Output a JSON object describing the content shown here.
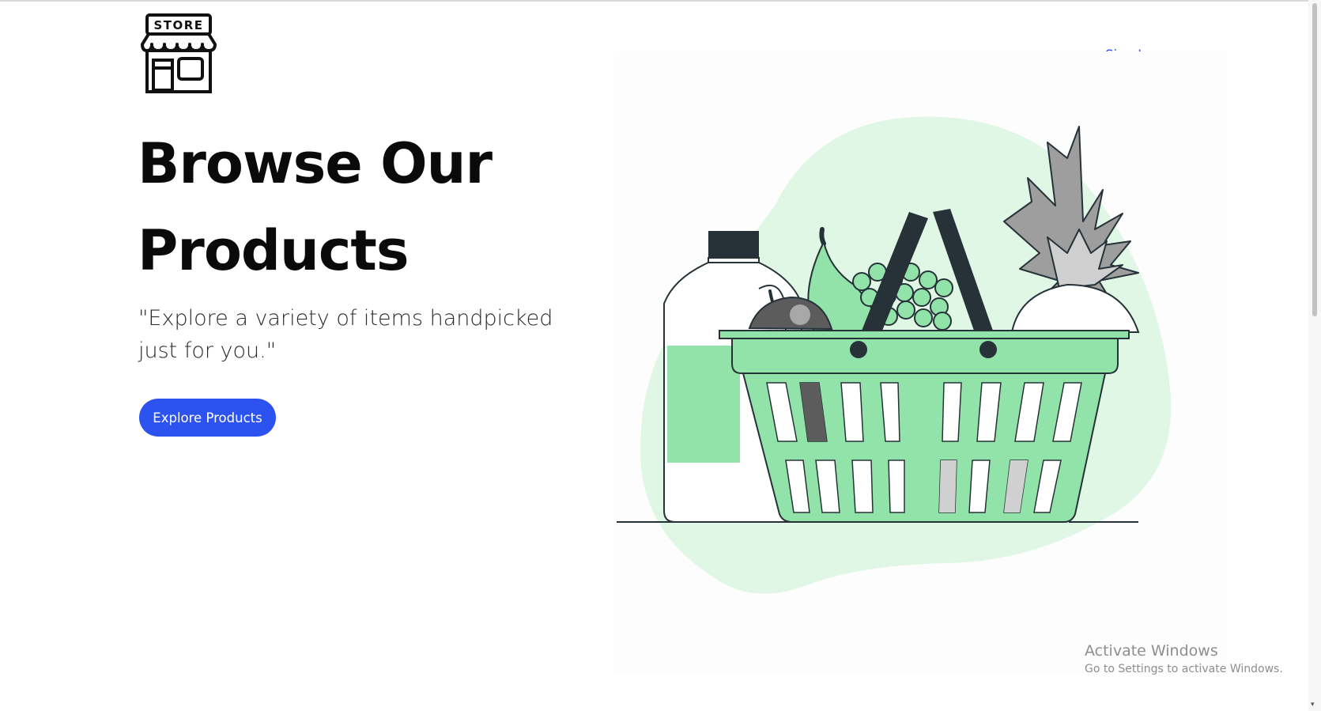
{
  "header": {
    "logo_text": "STORE",
    "signin_label": "Sign In"
  },
  "hero": {
    "title_line1": "Browse Our",
    "title_line2": "Products",
    "subtitle": "\"Explore a variety of items handpicked just for you.\"",
    "cta_label": "Explore Products"
  },
  "illustration": {
    "icon": "grocery-basket-illustration"
  },
  "watermark": {
    "title": "Activate Windows",
    "subtitle": "Go to Settings to activate Windows."
  },
  "colors": {
    "accent": "#2c53f0",
    "illustration_green": "#92e3a9",
    "blob_green": "#e0f7e6",
    "dark_outline": "#263238"
  }
}
